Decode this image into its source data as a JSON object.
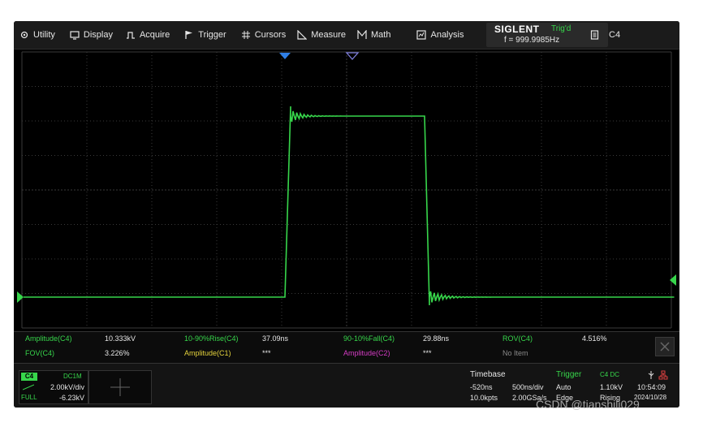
{
  "menu": {
    "items": [
      {
        "id": "utility",
        "label": "Utility",
        "icon": "gear-icon"
      },
      {
        "id": "display",
        "label": "Display",
        "icon": "monitor-icon"
      },
      {
        "id": "acquire",
        "label": "Acquire",
        "icon": "acquire-icon"
      },
      {
        "id": "trigger",
        "label": "Trigger",
        "icon": "flag-icon"
      },
      {
        "id": "cursors",
        "label": "Cursors",
        "icon": "hash-icon"
      },
      {
        "id": "measure",
        "label": "Measure",
        "icon": "ruler-icon"
      },
      {
        "id": "math",
        "label": "Math",
        "icon": "math-icon"
      },
      {
        "id": "analysis",
        "label": "Analysis",
        "icon": "analysis-icon"
      }
    ],
    "brand": "SIGLENT",
    "trigger_status": "Trig'd",
    "frequency": "f = 999.9985Hz",
    "channel_button": "C4"
  },
  "colors": {
    "trace": "#37d64b",
    "grid": "#3a3a3a",
    "marker_timebase": "#2f7fe6",
    "marker_trigger": "#7b7bd6"
  },
  "measurements": {
    "row1": [
      {
        "label": "Amplitude(C4)",
        "value": "10.333kV"
      },
      {
        "label": "10-90%Rise(C4)",
        "value": "37.09ns"
      },
      {
        "label": "90-10%Fall(C4)",
        "value": "29.88ns"
      },
      {
        "label": "ROV(C4)",
        "value": "4.516%"
      }
    ],
    "row2": [
      {
        "label": "FOV(C4)",
        "value": "3.226%"
      },
      {
        "label": "Amplitude(C1)",
        "value": "***"
      },
      {
        "label": "Amplitude(C2)",
        "value": "***"
      },
      {
        "label": "No Item",
        "value": ""
      }
    ]
  },
  "channel": {
    "label": "C4",
    "coupling": "DC1M",
    "scale": "2.00kV/div",
    "bandwidth": "FULL",
    "offset": "-6.23kV"
  },
  "timebase": {
    "title": "Timebase",
    "delay": "-520ns",
    "scale": "500ns/div",
    "points": "10.0kpts",
    "sample_rate": "2.00GSa/s"
  },
  "trigger": {
    "title": "Trigger",
    "source": "C4 DC",
    "mode": "Auto",
    "level": "1.10kV",
    "type": "Edge",
    "slope": "Rising"
  },
  "clock": {
    "time": "10:54:09",
    "date": "2024/10/28"
  },
  "watermark": "CSDN @tianshili029"
}
